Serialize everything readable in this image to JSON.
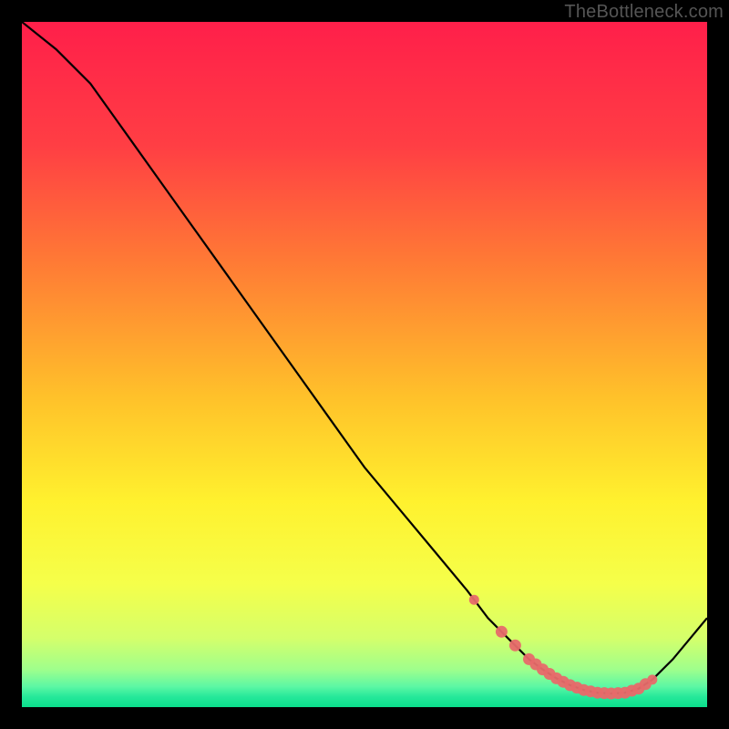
{
  "attribution": "TheBottleneck.com",
  "chart_data": {
    "type": "line",
    "title": "",
    "xlabel": "",
    "ylabel": "",
    "xlim": [
      0,
      100
    ],
    "ylim": [
      0,
      100
    ],
    "x": [
      0,
      5,
      10,
      15,
      20,
      25,
      30,
      35,
      40,
      45,
      50,
      55,
      60,
      65,
      68,
      70,
      72,
      74,
      76,
      78,
      80,
      82,
      84,
      86,
      88,
      90,
      92,
      95,
      100
    ],
    "values": [
      100,
      96,
      91,
      84,
      77,
      70,
      63,
      56,
      49,
      42,
      35,
      29,
      23,
      17,
      13,
      11,
      9,
      7,
      5.5,
      4.2,
      3.2,
      2.5,
      2.1,
      2.0,
      2.1,
      2.7,
      4.0,
      7.0,
      13
    ],
    "valley_markers_x": [
      66,
      70,
      72,
      74,
      75,
      76,
      77,
      78,
      79,
      80,
      81,
      82,
      83,
      84,
      85,
      86,
      87,
      88,
      89,
      90,
      91,
      92
    ],
    "gradient_stops": [
      {
        "offset": 0.0,
        "color": "#ff1f4a"
      },
      {
        "offset": 0.18,
        "color": "#ff3e44"
      },
      {
        "offset": 0.35,
        "color": "#ff7a35"
      },
      {
        "offset": 0.55,
        "color": "#ffc22a"
      },
      {
        "offset": 0.7,
        "color": "#fff12e"
      },
      {
        "offset": 0.82,
        "color": "#f5ff4a"
      },
      {
        "offset": 0.9,
        "color": "#d4ff6b"
      },
      {
        "offset": 0.945,
        "color": "#9fff8c"
      },
      {
        "offset": 0.97,
        "color": "#5cf7a4"
      },
      {
        "offset": 0.985,
        "color": "#26e89a"
      },
      {
        "offset": 1.0,
        "color": "#0adf8b"
      }
    ]
  }
}
